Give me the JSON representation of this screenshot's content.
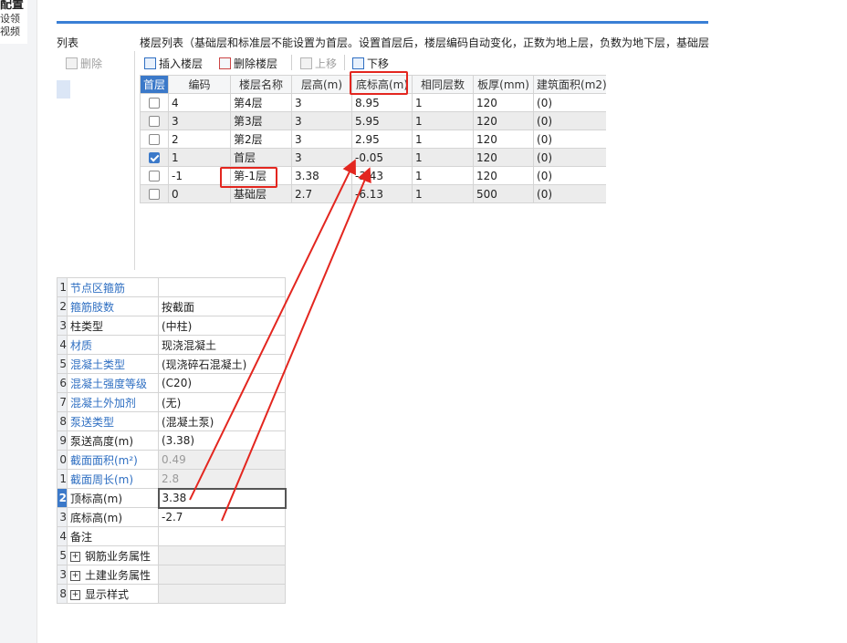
{
  "left_panel": {
    "title": "配置",
    "sub_lines": [
      "设领",
      "视频"
    ]
  },
  "left_list": {
    "title": "列表",
    "delete_label": "删除"
  },
  "floor_panel": {
    "title": "楼层列表（基础层和标准层不能设置为首层。设置首层后，楼层编码自动变化，正数为地上层，负数为地下层，基础层",
    "toolbar": {
      "insert": "插入楼层",
      "delete": "删除楼层",
      "up": "上移",
      "down": "下移"
    },
    "columns": [
      "首层",
      "编码",
      "楼层名称",
      "层高(m)",
      "底标高(m)",
      "相同层数",
      "板厚(mm)",
      "建筑面积(m2)"
    ],
    "rows": [
      {
        "checked": false,
        "code": "4",
        "name": "第4层",
        "height": "3",
        "bottom": "8.95",
        "same": "1",
        "slab": "120",
        "area": "(0)"
      },
      {
        "checked": false,
        "code": "3",
        "name": "第3层",
        "height": "3",
        "bottom": "5.95",
        "same": "1",
        "slab": "120",
        "area": "(0)"
      },
      {
        "checked": false,
        "code": "2",
        "name": "第2层",
        "height": "3",
        "bottom": "2.95",
        "same": "1",
        "slab": "120",
        "area": "(0)"
      },
      {
        "checked": true,
        "code": "1",
        "name": "首层",
        "height": "3",
        "bottom": "-0.05",
        "same": "1",
        "slab": "120",
        "area": "(0)"
      },
      {
        "checked": false,
        "code": "-1",
        "name": "第-1层",
        "height": "3.38",
        "bottom": "-3.43",
        "same": "1",
        "slab": "120",
        "area": "(0)"
      },
      {
        "checked": false,
        "code": "0",
        "name": "基础层",
        "height": "2.7",
        "bottom": "-6.13",
        "same": "1",
        "slab": "500",
        "area": "(0)"
      }
    ]
  },
  "properties": {
    "rows": [
      {
        "num": "1",
        "name": "节点区箍筋",
        "value": "",
        "blue": true
      },
      {
        "num": "2",
        "name": "箍筋肢数",
        "value": "按截面",
        "blue": true
      },
      {
        "num": "3",
        "name": "柱类型",
        "value": "(中柱)",
        "blue": false
      },
      {
        "num": "4",
        "name": "材质",
        "value": "现浇混凝土",
        "blue": true
      },
      {
        "num": "5",
        "name": "混凝土类型",
        "value": "(现浇碎石混凝土)",
        "blue": true
      },
      {
        "num": "6",
        "name": "混凝土强度等级",
        "value": "(C20)",
        "blue": true
      },
      {
        "num": "7",
        "name": "混凝土外加剂",
        "value": "(无)",
        "blue": true
      },
      {
        "num": "8",
        "name": "泵送类型",
        "value": "(混凝土泵)",
        "blue": true
      },
      {
        "num": "9",
        "name": "泵送高度(m)",
        "value": "(3.38)",
        "blue": false
      },
      {
        "num": "0",
        "name": "截面面积(m²)",
        "value": "0.49",
        "blue": true,
        "gray": true
      },
      {
        "num": "1",
        "name": "截面周长(m)",
        "value": "2.8",
        "blue": true,
        "gray": true
      },
      {
        "num": "2",
        "name": "顶标高(m)",
        "value": "3.38",
        "blue": false,
        "selected": true
      },
      {
        "num": "3",
        "name": "底标高(m)",
        "value": "-2.7",
        "blue": false
      },
      {
        "num": "4",
        "name": "备注",
        "value": "",
        "blue": false
      },
      {
        "num": "5",
        "name": "钢筋业务属性",
        "value": "",
        "blue": false,
        "expand": true
      },
      {
        "num": "3",
        "name": "土建业务属性",
        "value": "",
        "blue": false,
        "expand": true
      },
      {
        "num": "8",
        "name": "显示样式",
        "value": "",
        "blue": false,
        "expand": true
      }
    ]
  },
  "colors": {
    "accent": "#3b79c9",
    "annotation_red": "#e3261f"
  }
}
